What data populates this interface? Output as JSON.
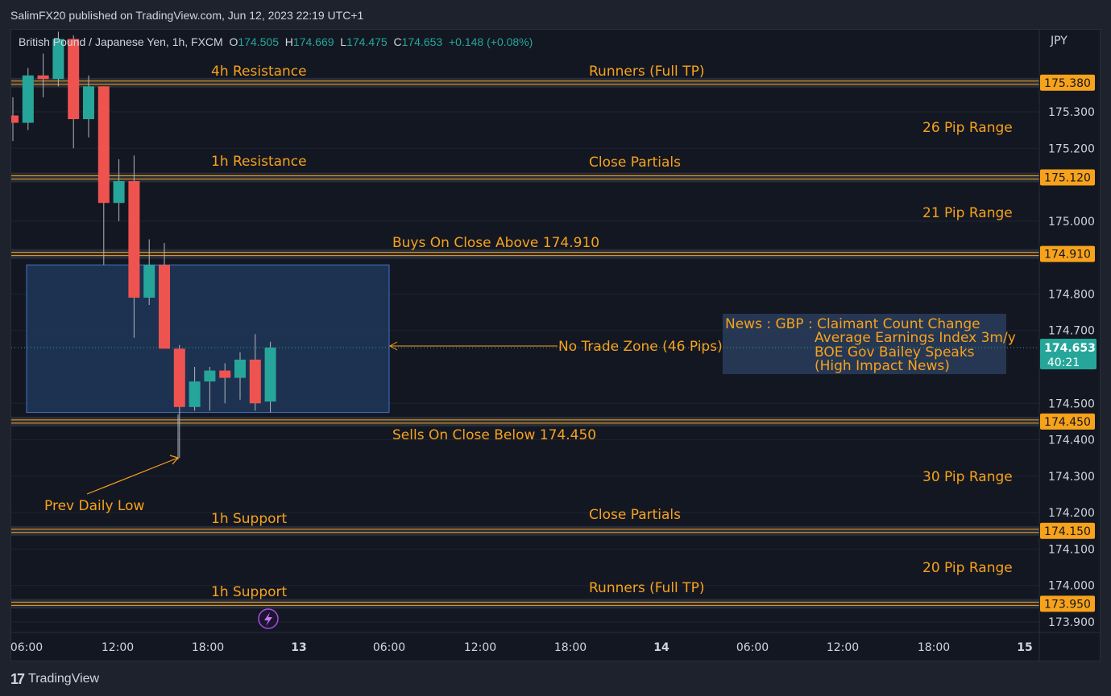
{
  "header": {
    "text": "SalimFX20 published on TradingView.com, Jun 12, 2023 22:19 UTC+1"
  },
  "legend": {
    "symbol": "British Pound / Japanese Yen, 1h, FXCM",
    "o_label": "O",
    "o": "174.505",
    "h_label": "H",
    "h": "174.669",
    "l_label": "L",
    "l": "174.475",
    "c_label": "C",
    "c": "174.653",
    "change": "+0.148 (+0.08%)"
  },
  "footer": {
    "logo": "17",
    "brand": "TradingView"
  },
  "colors": {
    "background": "#131722",
    "up": "#26a69a",
    "down": "#ef5350",
    "level_orange": "#f7a21b",
    "annotation_text": "#f7a21b",
    "zone_fill": "#1e3556",
    "zone_border": "#4a7bd8",
    "grid": "#1f2433"
  },
  "chart_data": {
    "type": "candlestick",
    "symbol": "GBPJPY",
    "timeframe": "1h",
    "currency": "JPY",
    "x_labels": [
      "06:00",
      "12:00",
      "18:00",
      "13",
      "06:00",
      "12:00",
      "18:00",
      "14",
      "06:00",
      "12:00",
      "18:00",
      "15"
    ],
    "y_ticks": [
      "175.300",
      "175.200",
      "175.000",
      "174.800",
      "174.700",
      "174.500",
      "174.400",
      "174.300",
      "174.200",
      "174.100",
      "174.000",
      "173.900"
    ],
    "ylim": [
      173.84,
      175.46
    ],
    "candles": [
      {
        "t": "06:00",
        "o": 175.29,
        "h": 175.34,
        "l": 175.22,
        "c": 175.27
      },
      {
        "t": "07:00",
        "o": 175.27,
        "h": 175.42,
        "l": 175.25,
        "c": 175.4
      },
      {
        "t": "08:00",
        "o": 175.4,
        "h": 175.46,
        "l": 175.34,
        "c": 175.39
      },
      {
        "t": "09:00",
        "o": 175.39,
        "h": 175.52,
        "l": 175.37,
        "c": 175.5
      },
      {
        "t": "10:00",
        "o": 175.5,
        "h": 175.51,
        "l": 175.2,
        "c": 175.28
      },
      {
        "t": "11:00",
        "o": 175.28,
        "h": 175.4,
        "l": 175.23,
        "c": 175.37
      },
      {
        "t": "12:00",
        "o": 175.37,
        "h": 175.37,
        "l": 174.88,
        "c": 175.05
      },
      {
        "t": "13:00",
        "o": 175.05,
        "h": 175.17,
        "l": 175.0,
        "c": 175.11
      },
      {
        "t": "14:00",
        "o": 175.11,
        "h": 175.18,
        "l": 174.68,
        "c": 174.79
      },
      {
        "t": "15:00",
        "o": 174.79,
        "h": 174.95,
        "l": 174.77,
        "c": 174.88
      },
      {
        "t": "16:00",
        "o": 174.88,
        "h": 174.94,
        "l": 174.65,
        "c": 174.65
      },
      {
        "t": "17:00",
        "o": 174.65,
        "h": 174.66,
        "l": 174.35,
        "c": 174.49
      },
      {
        "t": "18:00",
        "o": 174.49,
        "h": 174.6,
        "l": 174.48,
        "c": 174.56
      },
      {
        "t": "19:00",
        "o": 174.56,
        "h": 174.6,
        "l": 174.48,
        "c": 174.59
      },
      {
        "t": "20:00",
        "o": 174.59,
        "h": 174.61,
        "l": 174.5,
        "c": 174.57
      },
      {
        "t": "21:00",
        "o": 174.57,
        "h": 174.64,
        "l": 174.51,
        "c": 174.62
      },
      {
        "t": "22:00",
        "o": 174.62,
        "h": 174.69,
        "l": 174.48,
        "c": 174.5
      },
      {
        "t": "23:00",
        "o": 174.505,
        "h": 174.669,
        "l": 174.475,
        "c": 174.653
      }
    ],
    "levels": [
      {
        "price": 175.38,
        "label": "175.380"
      },
      {
        "price": 175.12,
        "label": "175.120"
      },
      {
        "price": 174.91,
        "label": "174.910"
      },
      {
        "price": 174.45,
        "label": "174.450"
      },
      {
        "price": 174.15,
        "label": "174.150"
      },
      {
        "price": 173.95,
        "label": "173.950"
      }
    ],
    "current_price": {
      "price": 174.653,
      "label": "174.653",
      "countdown": "40:21"
    },
    "annotations": {
      "res4h": "4h Resistance",
      "runners_top": "Runners (Full TP)",
      "range26": "26 Pip Range",
      "res1h": "1h Resistance",
      "partials_top": "Close Partials",
      "range21": "21 Pip Range",
      "buys": "Buys On Close Above 174.910",
      "no_trade": "No Trade Zone (46 Pips)",
      "sells": "Sells On Close Below 174.450",
      "range30": "30 Pip Range",
      "prev_low": "Prev Daily Low",
      "sup1h_a": "1h Support",
      "partials_bottom": "Close Partials",
      "range20": "20 Pip Range",
      "sup1h_b": "1h Support",
      "runners_bottom": "Runners (Full TP)",
      "news": [
        "News : GBP : Claimant Count Change",
        "Average Earnings Index 3m/y",
        "BOE Gov Bailey Speaks",
        "(High Impact News)"
      ]
    },
    "no_trade_zone": {
      "from_candle": 0,
      "to_hour": "06:00",
      "price_top": 174.88,
      "price_bottom": 174.475
    }
  }
}
